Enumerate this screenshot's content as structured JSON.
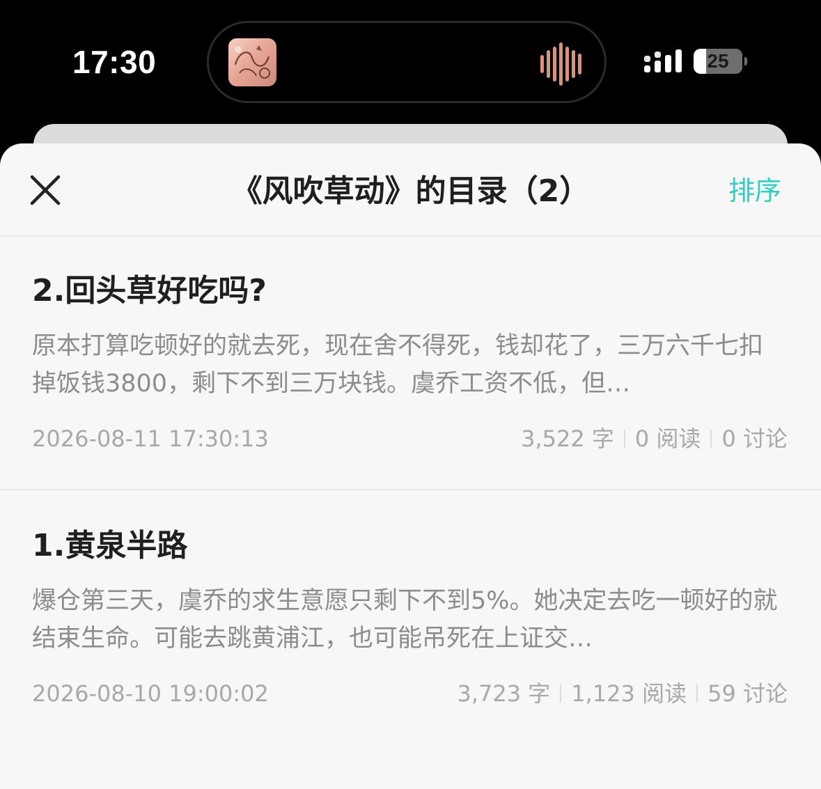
{
  "status_bar": {
    "time": "17:30",
    "battery_level": "25",
    "battery_fraction": 0.25,
    "album_art_icon": "album-art-icon",
    "audio_icon": "audio-waveform-icon",
    "signal_icon": "cellular-signal-icon",
    "waveform_color": "#d7937b"
  },
  "sheet": {
    "title": "《风吹草动》的目录（2）",
    "sort_label": "排序",
    "close_icon": "close-icon",
    "accent_color": "#2ccfc0"
  },
  "chapters": [
    {
      "title": "2.回头草好吃吗?",
      "summary": "原本打算吃顿好的就去死，现在舍不得死，钱却花了，三万六千七扣掉饭钱3800，剩下不到三万块钱。虞乔工资不低，但…",
      "date": "2026-08-11 17:30:13",
      "words": "3,522 字",
      "reads": "0 阅读",
      "comments": "0 讨论"
    },
    {
      "title": "1.黄泉半路",
      "summary": "爆仓第三天，虞乔的求生意愿只剩下不到5%。她决定去吃一顿好的就结束生命。可能去跳黄浦江，也可能吊死在上证交…",
      "date": "2026-08-10 19:00:02",
      "words": "3,723 字",
      "reads": "1,123 阅读",
      "comments": "59 讨论"
    }
  ]
}
